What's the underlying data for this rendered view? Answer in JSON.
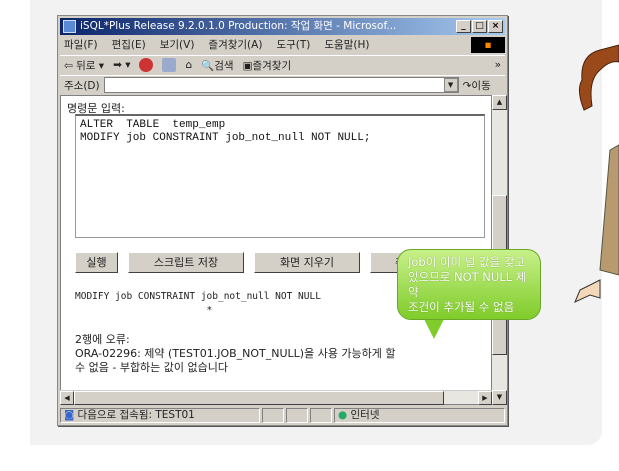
{
  "window": {
    "title": "iSQL*Plus Release 9.2.0.1.0 Production: 작업 화면 - Microsof...",
    "controls": [
      "_",
      "□",
      "×"
    ]
  },
  "menu": [
    "파일(F)",
    "편집(E)",
    "보기(V)",
    "즐겨찾기(A)",
    "도구(T)",
    "도움말(H)"
  ],
  "toolbar": {
    "back": "뒤로",
    "search": "검색",
    "favorites": "즐겨찾기",
    "more": "»"
  },
  "address": {
    "label": "주소(D)",
    "value": "",
    "go": "이동"
  },
  "editor": {
    "label": "명령문 입력:",
    "sql": "ALTER  TABLE  temp_emp\nMODIFY job CONSTRAINT job_not_null NOT NULL;"
  },
  "buttons": [
    "실행",
    "스크립트 저장",
    "화면 지우기",
    "취"
  ],
  "output": {
    "echo": "MODIFY job CONSTRAINT job_not_null NOT NULL\n                       *",
    "error_line": "2행에 오류:",
    "error_msg": "ORA-02296: 제약 (TEST01.JOB_NOT_NULL)을 사용 가능하게 할",
    "error_msg2": "수 없음 - 부합하는 값이 없습니다"
  },
  "status": {
    "connected": "다음으로 접속됨: TEST01",
    "zone": "인터넷"
  },
  "callout": {
    "line1": "Job이 이미 널 값을 갖고",
    "line2": "있으므로 NOT NULL 제약",
    "line3": "조건이 추가될 수 없음"
  }
}
